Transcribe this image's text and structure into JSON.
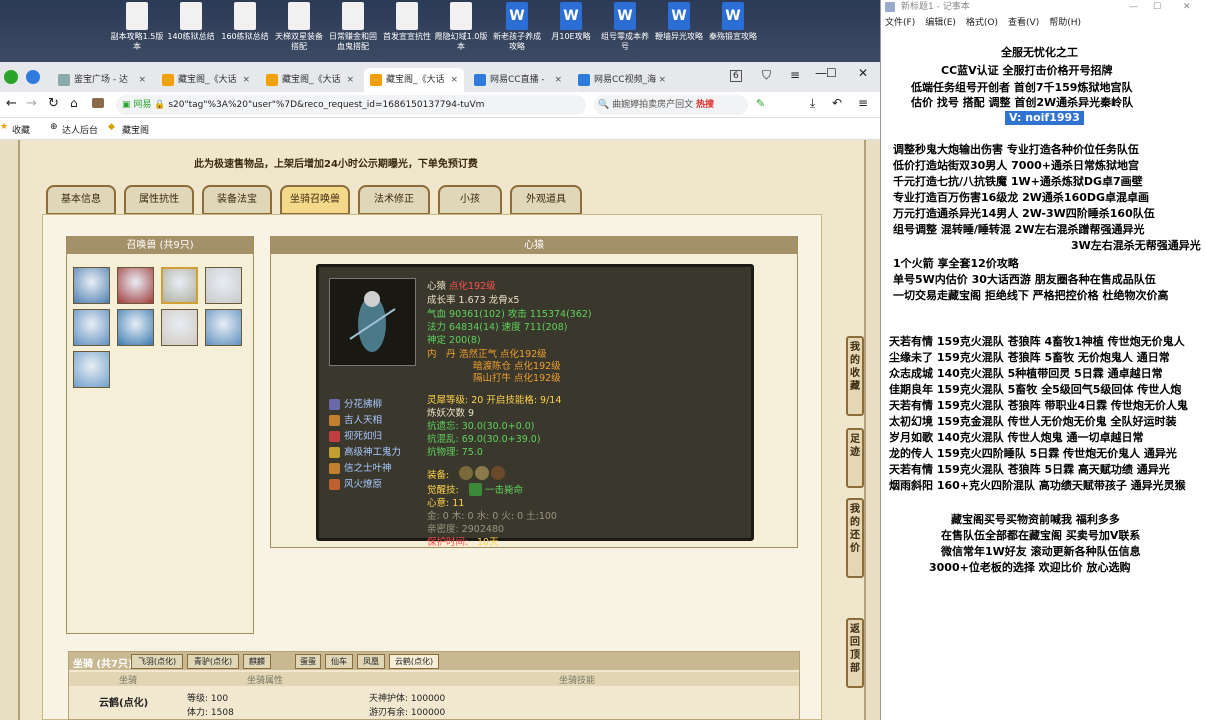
{
  "desktop": {
    "icons": [
      {
        "label": "副本攻略1.5版本",
        "type": "doc"
      },
      {
        "label": "140练狱总结",
        "type": "doc"
      },
      {
        "label": "160练狱总结",
        "type": "doc"
      },
      {
        "label": "天梯双星装备搭配",
        "type": "doc"
      },
      {
        "label": "日常赚金和固血鬼搭配",
        "type": "doc"
      },
      {
        "label": "首发宣宣抗性",
        "type": "doc"
      },
      {
        "label": "霞隐幻域1.0版本",
        "type": "doc"
      },
      {
        "label": "新老孩子养成攻略",
        "type": "word"
      },
      {
        "label": "月10E攻略",
        "type": "word"
      },
      {
        "label": "组号零成本养号",
        "type": "word"
      },
      {
        "label": "鞭墙异光攻略",
        "type": "word"
      },
      {
        "label": "秦殇锻宣攻略",
        "type": "word"
      }
    ]
  },
  "browser": {
    "tabs": [
      {
        "label": "鉴宝广场 - 达",
        "active": false
      },
      {
        "label": "藏宝阁_《大话",
        "active": false
      },
      {
        "label": "藏宝阁_《大话",
        "active": false
      },
      {
        "label": "藏宝阁_《大话",
        "active": true
      },
      {
        "label": "网易CC直播 -",
        "active": false
      },
      {
        "label": "网易CC视频_海",
        "active": false
      }
    ],
    "url_prefix": "网易",
    "url": "s20\"tag\"%3A%20\"user\"%7D&reco_request_id=1686150137794-tuVm",
    "search_placeholder": "曲婉婷拍卖房产回文",
    "hot_label": "热搜",
    "bookmarks": [
      "收藏",
      "达人后台",
      "藏宝阁"
    ],
    "tab_counter": "6"
  },
  "game": {
    "notice_top": "此为极速售物品，上架后增加24小时公示期曝光，下单免预订费",
    "tabs": [
      "基本信息",
      "属性抗性",
      "装备法宝",
      "坐骑召唤兽",
      "法术修正",
      "小孩",
      "外观道具"
    ],
    "active_tab": 3,
    "pet_panel_title": "召唤兽 (共9只)",
    "detail_title": "心猿",
    "pet": {
      "name": "心猿",
      "badge": "点化192级",
      "growth": "成长率 1.673 龙骨x5",
      "hp": "气血 90361(102) 攻击 115374(362)",
      "mp": "法力 64834(14) 速度 711(208)",
      "shen": "神定 200(8)",
      "neidan_label": "内　丹",
      "neidan": [
        "浩然正气 点化192级",
        "暗渡陈仓 点化192级",
        "隔山打牛 点化192级"
      ],
      "skills": [
        "分花拂柳",
        "吉人天相",
        "视死如归",
        "高级神工鬼力",
        "信之士叶神",
        "风火燎原"
      ],
      "lingxi": "灵犀等级: 20 开启技能格: 9/14",
      "lianyao": "炼妖次数 9",
      "kangyiwang": "抗遗忘: 30.0(30.0+0.0)",
      "kanghunluan": "抗混乱: 69.0(30.0+39.0)",
      "kangwuli": "抗物理: 75.0",
      "equip_label": "装备:",
      "awaken_label": "觉醒技:",
      "awaken": "一击毙命",
      "xinsu": "心意: 11",
      "elements": "金: 0 木: 0 水: 0 火: 0 土:100",
      "qinmi": "亲密度: 2902480",
      "protect_label": "保护时间:",
      "protect": "10天"
    },
    "side_buttons": [
      "我的收藏",
      "足迹",
      "我的还价",
      "返回顶部"
    ],
    "mounts": {
      "title": "坐骑 (共7只)",
      "tabs": [
        "飞羽(点化)",
        "青驴(点化)",
        "麒麟",
        "蛋蛋",
        "仙车",
        "凤凰",
        "云鹤(点化)"
      ],
      "col_attr": "坐骑属性",
      "col_skill": "坐骑技能",
      "col_name": "坐骑",
      "name": "云鹤(点化)",
      "level": "等级: 100",
      "body": "体力: 1508",
      "skill1": "天神护体: 100000",
      "skill2": "游刃有余: 100000"
    }
  },
  "notepad": {
    "title": "新标题1 - 记事本",
    "menu": [
      "文件(F)",
      "编辑(E)",
      "格式(O)",
      "查看(V)",
      "帮助(H)"
    ],
    "lines": [
      "全服无忧化之工",
      "CC蓝V认证  全服打击价格开号招牌",
      "低端任务组号开创者        首创7千159炼狱地宫队",
      "估价 找号 搭配 调整        首创2W通杀异光秦岭队",
      "V:  noif1993",
      "调整秒鬼大炮输出伤害        专业打造各种价位任务队伍",
      "低价打造站街双30男人        7000+通杀日常炼狱地宫",
      "千元打造七抗/八抗铁魔        1W+通杀炼狱DG卓7画壁",
      "专业打造百万伤害16级龙        2W通杀160DG卓混卓画",
      "万元打造通杀异光14男人        2W-3W四阶睡杀160队伍",
      "组号调整 混转睡/睡转混        2W左右混杀蹭帮强通异光",
      "3W左右混杀无帮强通异光",
      "1个火箭 享全套12价攻略",
      "单号5W内估价 30大话西游        朋友圈各种在售成品队伍",
      "一切交易走藏宝阁 拒绝线下    严格把控价格 杜绝物次价高",
      "天若有情 159克火混队 苍狼阵 4畜牧1神植 传世炮无价鬼人",
      "尘缘未了 159克火混队 苍狼阵 5畜牧 无价炮鬼人 通日常",
      "众志成城 140克火混队 5种植带回灵 5日霖 通卓越日常",
      "佳期良年 159克火混队 5畜牧 全5级回气5级回体 传世人炮",
      "天若有情 159克火混队 苍狼阵 带职业4日霖 传世炮无价人鬼",
      "太初幻境 159克金混队 传世人无价炮无价鬼 全队好运时装",
      "岁月如歌 140克火混队 传世人炮鬼 通一切卓越日常",
      "龙的传人 159克火四阶睡队 5日霖 传世炮无价鬼人 通异光",
      "天若有情 159克火混队 苍狼阵 5日霖 高天赋功绩 通异光",
      "烟雨斜阳 160+克火四阶混队 高功绩天赋带孩子 通异光灵猴",
      "藏宝阁买号买物资前喊我 福利多多",
      "在售队伍全部都在藏宝阁 买卖号加V联系",
      "微信常年1W好友 滚动更新各种队伍信息",
      "3000+位老板的选择 欢迎比价 放心选购"
    ]
  },
  "colors": {
    "accent": "#3074d0",
    "parchment": "#efe6cc",
    "dark_panel": "#3a372c"
  }
}
